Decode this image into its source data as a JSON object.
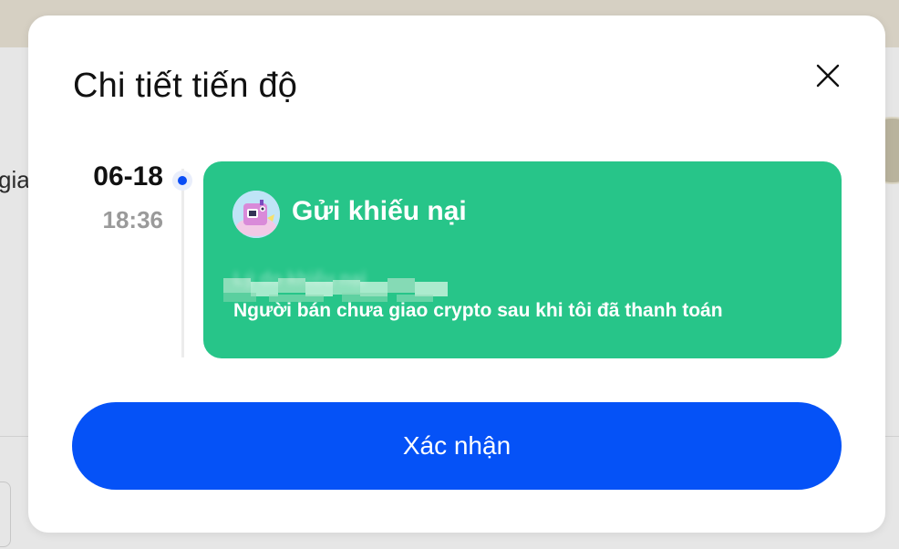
{
  "background": {
    "left_text": "gia"
  },
  "modal": {
    "title": "Chi tiết tiến độ",
    "close_icon": "close-icon",
    "timeline": {
      "date": "06-18",
      "time": "18:36",
      "dot_color": "#0a4df5"
    },
    "card": {
      "color": "#27c589",
      "avatar_icon": "user-avatar",
      "title": "Gửi khiếu nại",
      "subtitle": "Lý do khiếu nại",
      "description": "Người bán chưa giao crypto sau khi tôi đã thanh toán"
    },
    "confirm_button": {
      "label": "Xác nhận",
      "color": "#0552f7"
    }
  }
}
